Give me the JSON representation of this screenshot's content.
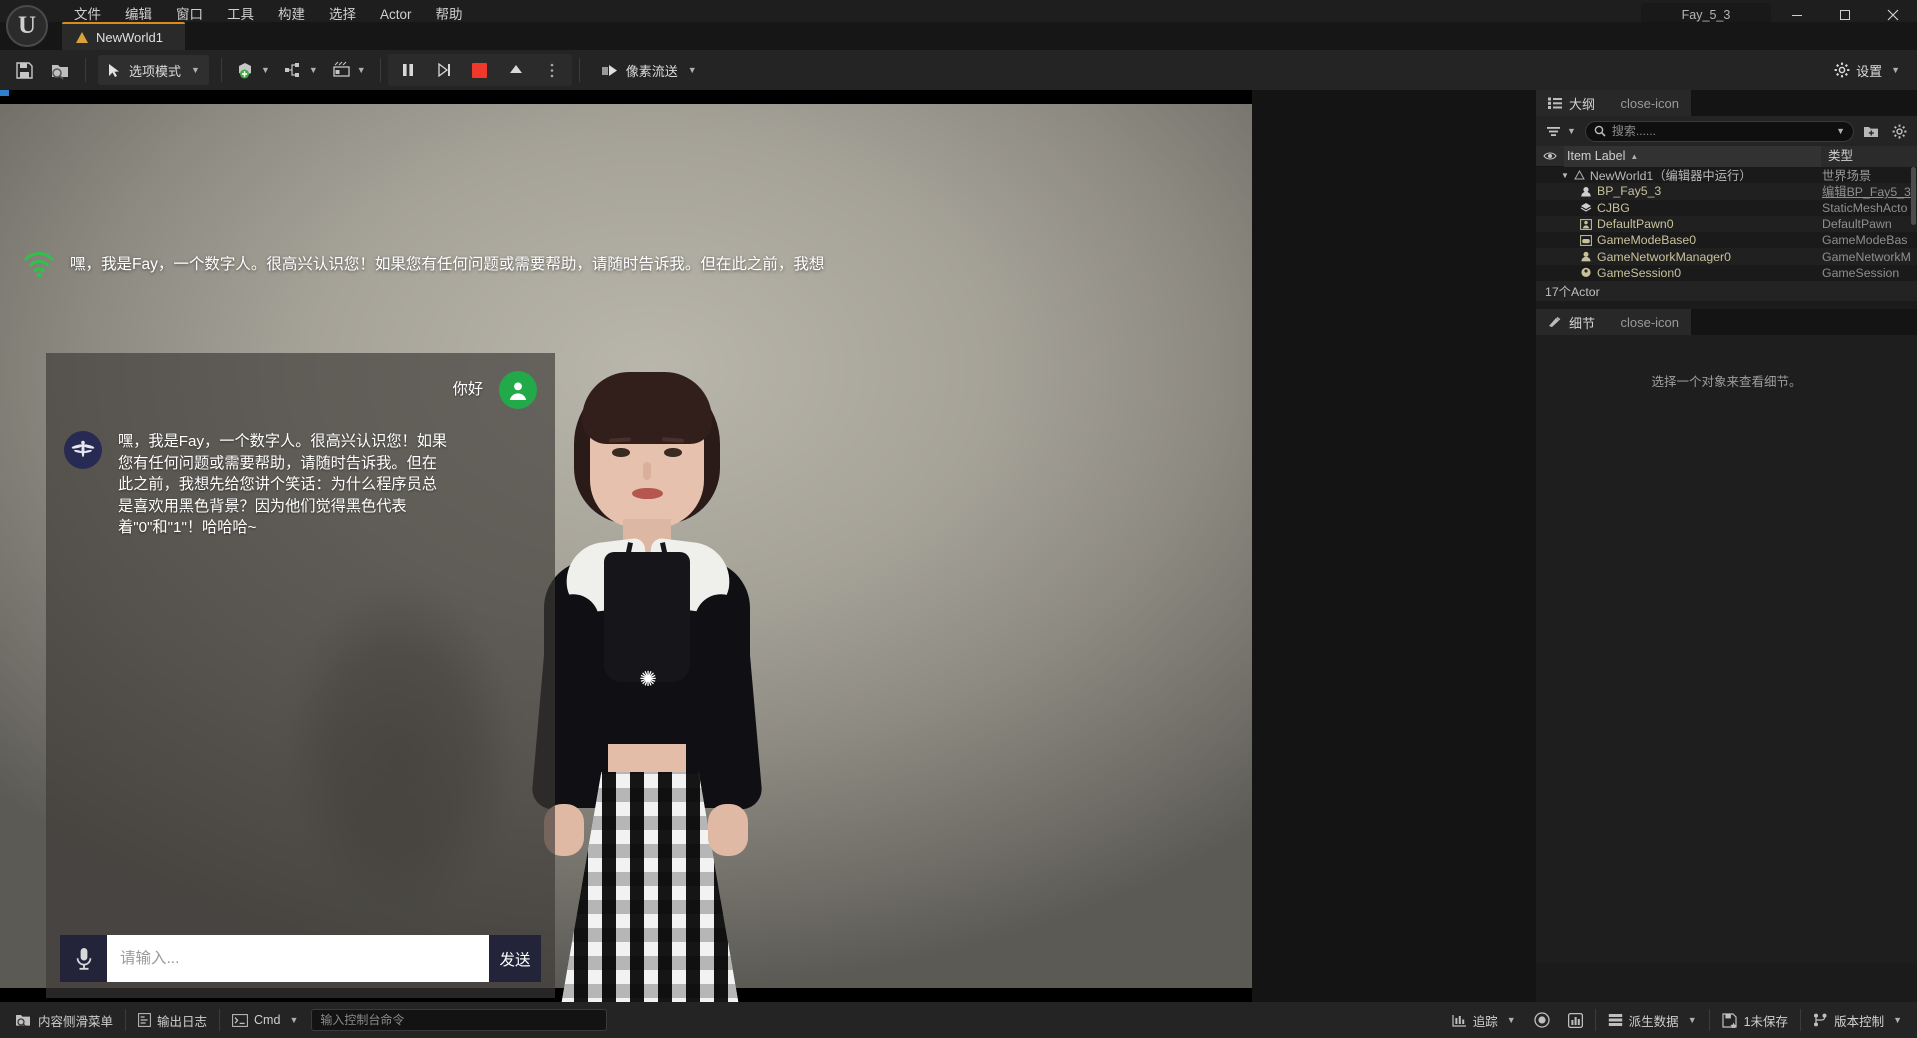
{
  "window": {
    "title": "Fay_5_3",
    "minimize": "—",
    "maximize": "▢",
    "close": "✕"
  },
  "menu": {
    "items": [
      {
        "label": "文件"
      },
      {
        "label": "编辑"
      },
      {
        "label": "窗口"
      },
      {
        "label": "工具"
      },
      {
        "label": "构建"
      },
      {
        "label": "选择"
      },
      {
        "label": "Actor"
      },
      {
        "label": "帮助"
      }
    ]
  },
  "level_tab": {
    "label": "NewWorld1"
  },
  "toolbar": {
    "save_icon": "save-icon",
    "browse_icon": "content-browser-icon",
    "mode_label": "选项模式",
    "add_icon": "add-actor-icon",
    "blueprint_icon": "blueprints-icon",
    "cinematics_icon": "cinematics-icon",
    "pause_icon": "pause-icon",
    "frameskip_icon": "frame-skip-icon",
    "stop_icon": "stop-icon",
    "eject_icon": "eject-icon",
    "more_icon": "more-options-icon",
    "pixel_stream_label": "像素流送",
    "settings_label": "设置"
  },
  "chat": {
    "banner_text": "嘿，我是Fay，一个数字人。很高兴认识您！如果您有任何问题或需要帮助，请随时告诉我。但在此之前，我想",
    "banner_icon": "wifi-signal-icon",
    "close_icon": "close-icon",
    "messages": [
      {
        "role": "user",
        "avatar": "user-avatar-icon",
        "text": "你好"
      },
      {
        "role": "bot",
        "avatar": "fay-avatar-icon",
        "text": "嘿，我是Fay，一个数字人。很高兴认识您！如果您有任何问题或需要帮助，请随时告诉我。但在此之前，我想先给您讲个笑话：为什么程序员总是喜欢用黑色背景？因为他们觉得黑色代表着\"0\"和\"1\"！哈哈哈~"
      }
    ],
    "input_placeholder": "请输入...",
    "input_value": "",
    "mic_icon": "microphone-icon",
    "send_label": "发送"
  },
  "outliner": {
    "tab_label": "大纲",
    "tab_icon": "outliner-icon",
    "close_icon": "close-icon",
    "filter_icon": "filter-icon",
    "search_placeholder": "搜索......",
    "search_value": "",
    "new_folder_icon": "new-folder-icon",
    "settings_icon": "gear-icon",
    "columns": {
      "visibility": "visibility-eye-icon",
      "label": "Item Label",
      "sort": "▲",
      "type": "类型"
    },
    "rows": [
      {
        "label": "NewWorld1（编辑器中运行）",
        "type": "世界场景",
        "icon": "world-icon",
        "depth": 0,
        "expanded": true,
        "is_root": true,
        "link": false
      },
      {
        "label": "BP_Fay5_3",
        "type": "编辑BP_Fay5_3",
        "icon": "pawn-icon",
        "depth": 1,
        "is_root": false,
        "link": true
      },
      {
        "label": "CJBG",
        "type": "StaticMeshActo",
        "icon": "static-mesh-icon",
        "depth": 1,
        "is_root": false,
        "link": false
      },
      {
        "label": "DefaultPawn0",
        "type": "DefaultPawn",
        "icon": "default-pawn-icon",
        "depth": 1,
        "is_root": false,
        "link": false
      },
      {
        "label": "GameModeBase0",
        "type": "GameModeBas",
        "icon": "gamemode-icon",
        "depth": 1,
        "is_root": false,
        "link": false
      },
      {
        "label": "GameNetworkManager0",
        "type": "GameNetworkM",
        "icon": "network-icon",
        "depth": 1,
        "is_root": false,
        "link": false
      },
      {
        "label": "GameSession0",
        "type": "GameSession",
        "icon": "session-icon",
        "depth": 1,
        "is_root": false,
        "link": false
      }
    ],
    "actor_count": "17个Actor"
  },
  "details": {
    "tab_label": "细节",
    "tab_icon": "details-icon",
    "close_icon": "close-icon",
    "empty_message": "选择一个对象来查看细节。"
  },
  "statusbar": {
    "content_drawer": "内容侧滑菜单",
    "content_drawer_icon": "content-drawer-icon",
    "output_log": "输出日志",
    "output_log_icon": "output-log-icon",
    "cmd_label": "Cmd",
    "cmd_icon": "console-icon",
    "cmd_placeholder": "输入控制台命令",
    "cmd_value": "",
    "trace_label": "追踪",
    "trace_icon": "trace-icon",
    "record_icon": "record-icon",
    "stats_icon": "stats-icon",
    "derived_data": "派生数据",
    "derived_data_icon": "derived-data-icon",
    "unsaved_label": "1未保存",
    "unsaved_icon": "unsaved-icon",
    "source_control": "版本控制",
    "source_control_icon": "source-control-icon"
  },
  "colors": {
    "accent_orange": "#d98c1a",
    "stop_red": "#f0392b",
    "link_blue": "#3c7fe0",
    "user_green": "#22a94a",
    "bot_navy": "#272a52",
    "wifi_green": "#2fc24a"
  }
}
